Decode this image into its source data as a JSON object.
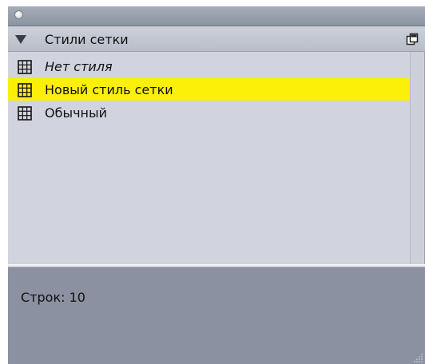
{
  "panel": {
    "section_title": "Стили сетки",
    "section_icon": "triangle-down-icon",
    "menu_icon": "palette-menu-icon",
    "close_icon": "close-dot-icon"
  },
  "styles_list": {
    "items": [
      {
        "label": "Нет стиля",
        "italic": true,
        "selected": false,
        "icon": "grid-icon"
      },
      {
        "label": "Новый стиль сетки",
        "italic": false,
        "selected": true,
        "icon": "grid-icon"
      },
      {
        "label": "Обычный",
        "italic": false,
        "selected": false,
        "icon": "grid-icon"
      }
    ]
  },
  "info": {
    "rows_text": "Строк: 10"
  },
  "colors": {
    "selection": "#fcef08",
    "list_background": "#d1d4de",
    "info_background": "#8b91a0"
  }
}
